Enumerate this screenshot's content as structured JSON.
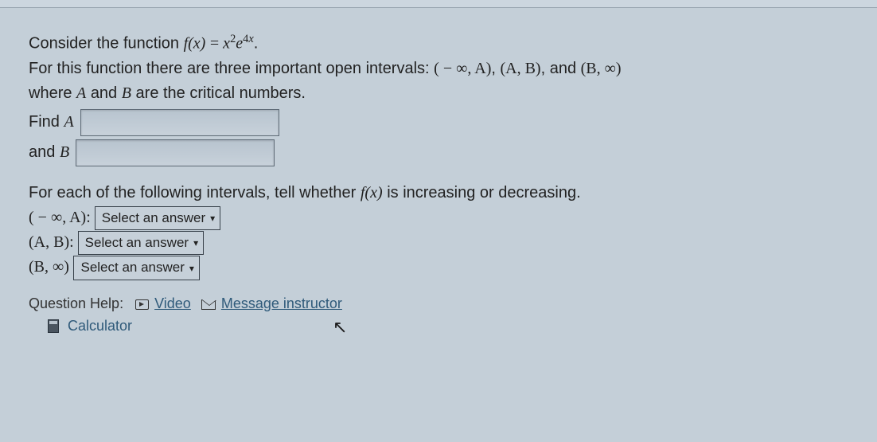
{
  "problem": {
    "line1_a": "Consider the function ",
    "func_lhs": "f(x)",
    "equals": " = ",
    "func_rhs_base1": "x",
    "func_rhs_exp1": "2",
    "func_rhs_base2": "e",
    "func_rhs_exp2": "4x",
    "line1_end": ".",
    "line2_a": "For this function there are three important open intervals: ",
    "interval1": "( − ∞, A)",
    "sep1": ", ",
    "interval2": "(A, B)",
    "sep2": ", and ",
    "interval3": "(B, ∞)",
    "line3": "where ",
    "A": "A",
    "and_txt": " and ",
    "B": "B",
    "line3_end": " are the critical numbers.",
    "findA": "Find ",
    "andB": "and "
  },
  "inputs": {
    "A_value": "",
    "B_value": ""
  },
  "part2": {
    "prompt_a": "For each of the following intervals, tell whether ",
    "fx": "f(x)",
    "prompt_b": " is increasing or decreasing.",
    "int1": "( − ∞, A)",
    "int2": "(A, B)",
    "int3": "(B, ∞)",
    "select_placeholder": "Select an answer"
  },
  "help": {
    "label": "Question Help:",
    "video": "Video",
    "message": "Message instructor",
    "calculator": "Calculator"
  }
}
